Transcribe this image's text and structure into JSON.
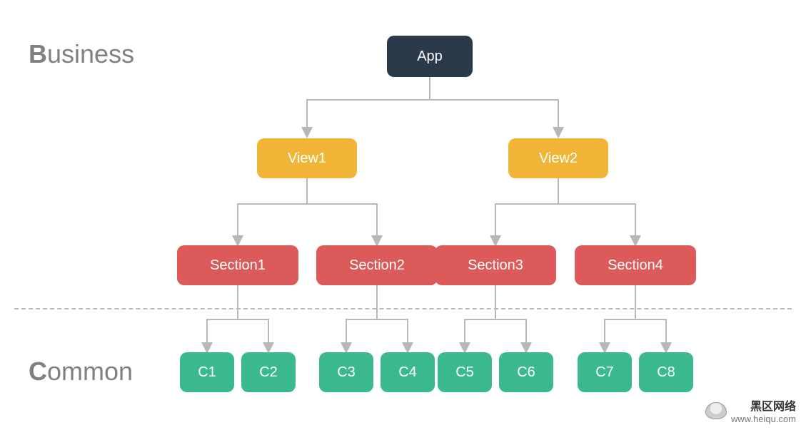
{
  "labels": {
    "business": "usiness",
    "business_b": "B",
    "common": "ommon",
    "common_c": "C"
  },
  "nodes": {
    "app": "App",
    "view1": "View1",
    "view2": "View2",
    "section1": "Section1",
    "section2": "Section2",
    "section3": "Section3",
    "section4": "Section4",
    "c1": "C1",
    "c2": "C2",
    "c3": "C3",
    "c4": "C4",
    "c5": "C5",
    "c6": "C6",
    "c7": "C7",
    "c8": "C8"
  },
  "watermark": {
    "title": "黑区网络",
    "url": "www.heiqu.com"
  },
  "colors": {
    "app": "#2b3a49",
    "view": "#f1b637",
    "section": "#dc5b5a",
    "component": "#3ab98d",
    "line": "#b8b8b8"
  }
}
